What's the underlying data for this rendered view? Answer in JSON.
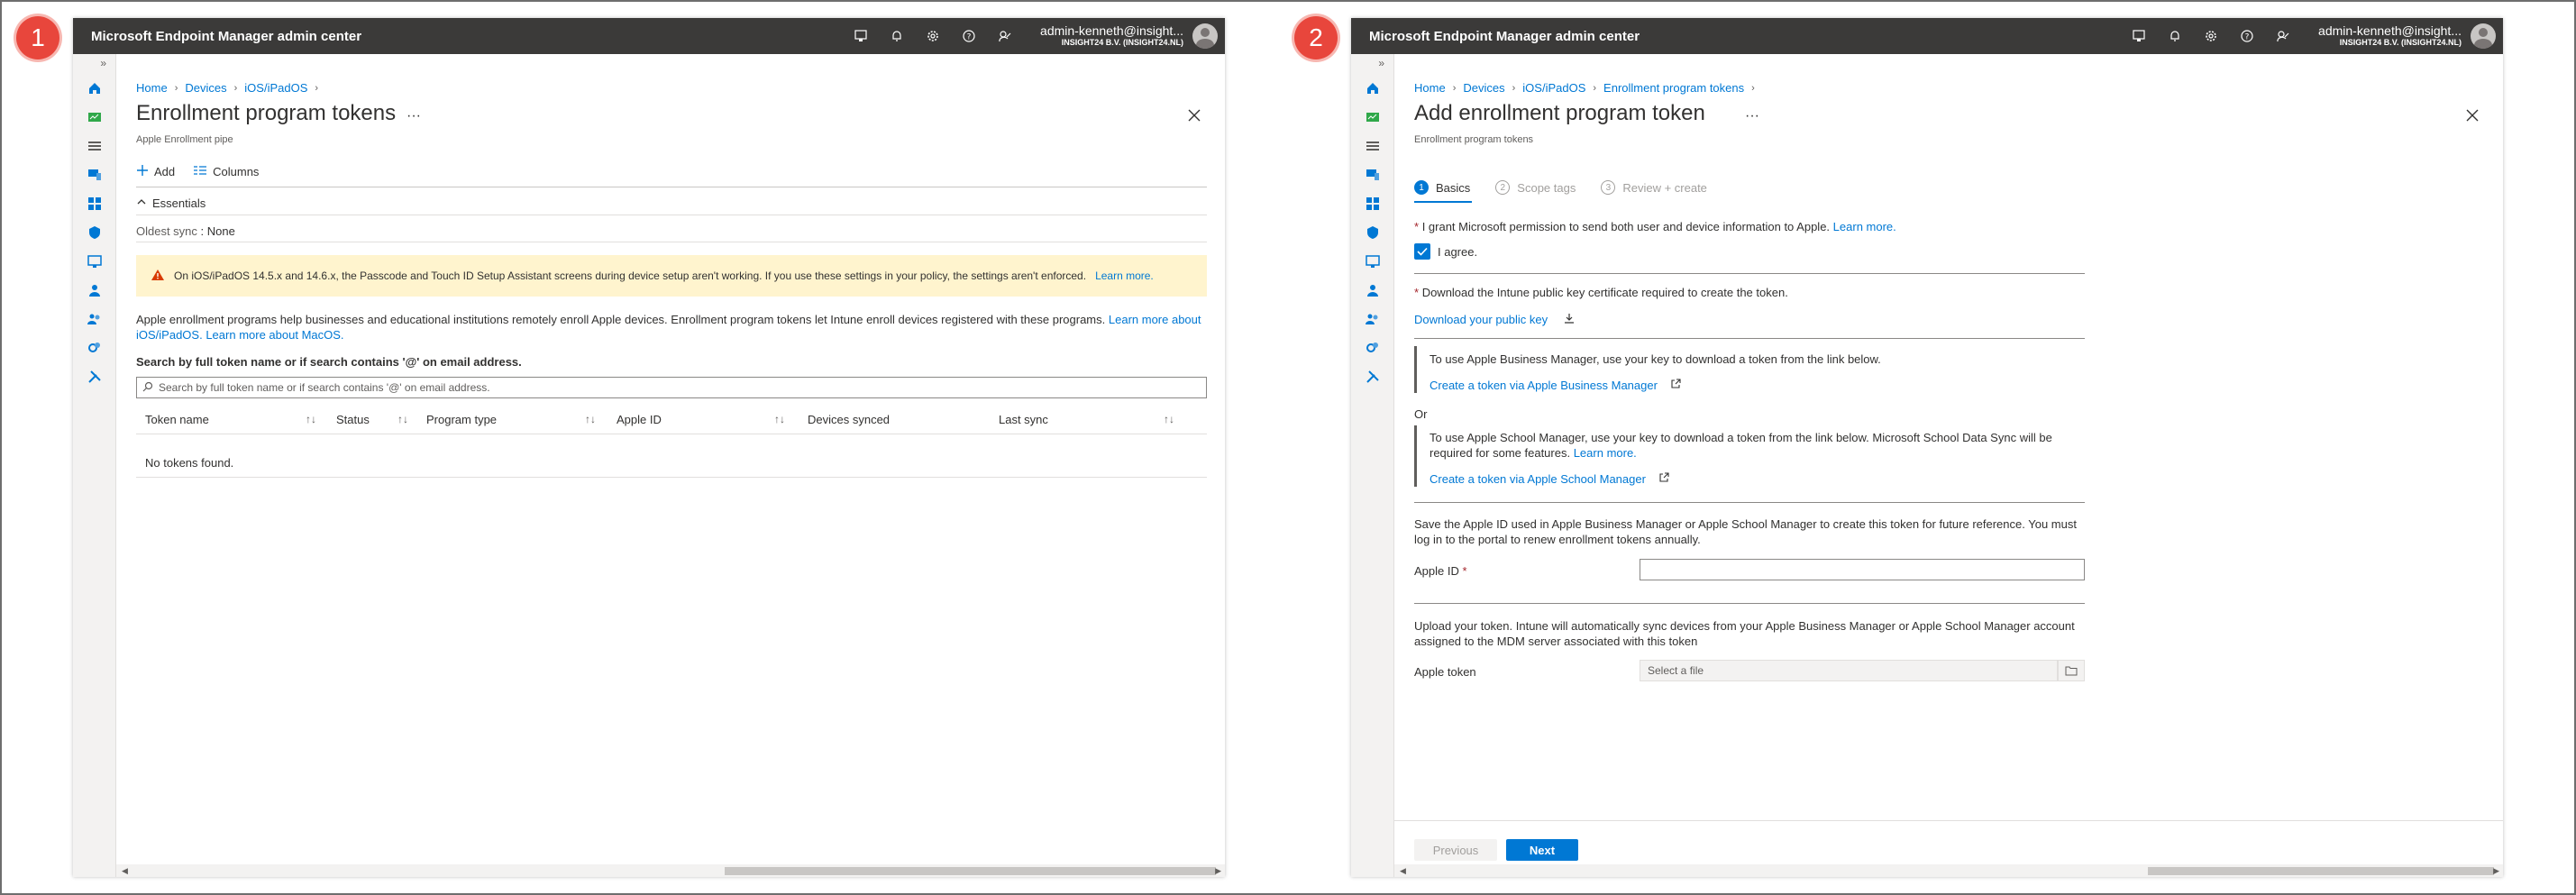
{
  "badges": [
    "1",
    "2"
  ],
  "app": {
    "title": "Microsoft Endpoint Manager admin center",
    "user_name": "admin-kenneth@insight...",
    "user_org": "INSIGHT24 B.V. (INSIGHT24.NL)",
    "nav_expand": "»"
  },
  "left": {
    "breadcrumb": [
      "Home",
      "Devices",
      "iOS/iPadOS"
    ],
    "title": "Enrollment program tokens",
    "subtitle": "Apple Enrollment pipe",
    "toolbar": {
      "add": "Add",
      "columns": "Columns"
    },
    "essentials": "Essentials",
    "oldest_sync_label": "Oldest sync",
    "oldest_sync_sep": ":",
    "oldest_sync_value": "None",
    "warning": "On iOS/iPadOS 14.5.x and 14.6.x, the Passcode and Touch ID Setup Assistant screens during device setup aren't working. If you use these settings in your policy, the settings aren't enforced.",
    "warning_link": "Learn more.",
    "description": "Apple enrollment programs help businesses and educational institutions remotely enroll Apple devices. Enrollment program tokens let Intune enroll devices registered with these programs.",
    "desc_link1": "Learn more about",
    "desc_link1b": "iOS/iPadOS.",
    "desc_link2": "Learn more about MacOS.",
    "search_label": "Search by full token name or if search contains '@' on email address.",
    "search_placeholder": "Search by full token name or if search contains '@' on email address.",
    "columns": [
      "Token name",
      "Status",
      "Program type",
      "Apple ID",
      "Devices synced",
      "Last sync"
    ],
    "sort_glyph": "↑↓",
    "empty": "No tokens found."
  },
  "right": {
    "breadcrumb": [
      "Home",
      "Devices",
      "iOS/iPadOS",
      "Enrollment program tokens"
    ],
    "title": "Add enrollment program token",
    "subtitle": "Enrollment program tokens",
    "tabs": [
      {
        "num": "1",
        "label": "Basics",
        "active": true
      },
      {
        "num": "2",
        "label": "Scope tags",
        "active": false
      },
      {
        "num": "3",
        "label": "Review + create",
        "active": false
      }
    ],
    "permission_text": "I grant Microsoft permission to send both user and device information to Apple.",
    "permission_link": "Learn more.",
    "agree_label": "I agree.",
    "download_text": "Download the Intune public key certificate required to create the token.",
    "download_link": "Download your public key",
    "abm_text": "To use Apple Business Manager, use your key to download a token from the link below.",
    "abm_link": "Create a token via Apple Business Manager",
    "or_text": "Or",
    "asm_text": "To use Apple School Manager, use your key to download a token from the link below. Microsoft School Data Sync will be required for some features.",
    "asm_link_inline": "Learn more.",
    "asm_link": "Create a token via Apple School Manager",
    "appleid_text": "Save the Apple ID used in Apple Business Manager or Apple School Manager to create this token for future reference. You must log in to the portal to renew enrollment tokens annually.",
    "appleid_label": "Apple ID",
    "required_mark": "*",
    "upload_text": "Upload your token. Intune will automatically sync devices from your Apple Business Manager or Apple School Manager account assigned to the MDM server associated with this token",
    "token_label": "Apple token",
    "token_placeholder": "Select a file",
    "prev_button": "Previous",
    "next_button": "Next"
  }
}
